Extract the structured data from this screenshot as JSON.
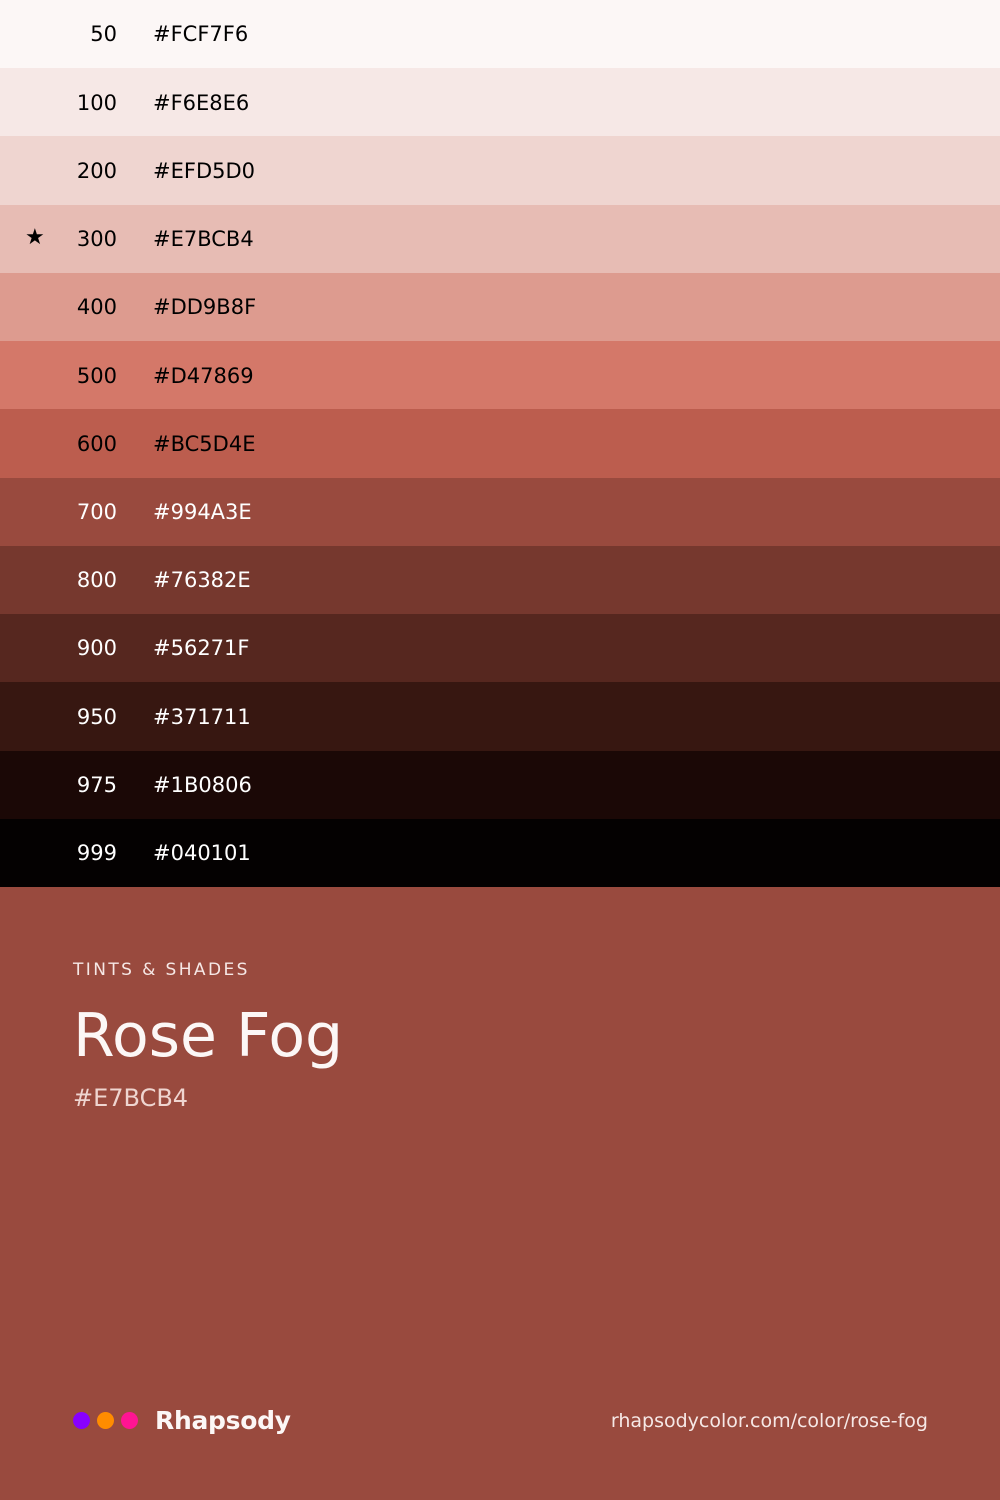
{
  "swatches": [
    {
      "shade": "50",
      "hex": "#FCF7F6",
      "text_color": "#000000",
      "starred": false
    },
    {
      "shade": "100",
      "hex": "#F6E8E6",
      "text_color": "#000000",
      "starred": false
    },
    {
      "shade": "200",
      "hex": "#EFD5D0",
      "text_color": "#000000",
      "starred": false
    },
    {
      "shade": "300",
      "hex": "#E7BCB4",
      "text_color": "#000000",
      "starred": true
    },
    {
      "shade": "400",
      "hex": "#DD9B8F",
      "text_color": "#000000",
      "starred": false
    },
    {
      "shade": "500",
      "hex": "#D47869",
      "text_color": "#000000",
      "starred": false
    },
    {
      "shade": "600",
      "hex": "#BC5D4E",
      "text_color": "#000000",
      "starred": false
    },
    {
      "shade": "700",
      "hex": "#994A3E",
      "text_color": "#FFFFFF",
      "starred": false
    },
    {
      "shade": "800",
      "hex": "#76382E",
      "text_color": "#FFFFFF",
      "starred": false
    },
    {
      "shade": "900",
      "hex": "#56271F",
      "text_color": "#FFFFFF",
      "starred": false
    },
    {
      "shade": "950",
      "hex": "#371711",
      "text_color": "#FFFFFF",
      "starred": false
    },
    {
      "shade": "975",
      "hex": "#1B0806",
      "text_color": "#FFFFFF",
      "starred": false
    },
    {
      "shade": "999",
      "hex": "#040101",
      "text_color": "#FFFFFF",
      "starred": false
    }
  ],
  "star_icon": "star-icon",
  "star_glyph": "★",
  "info": {
    "eyebrow": "TINTS & SHADES",
    "title": "Rose Fog",
    "base_hex": "#E7BCB4"
  },
  "footer": {
    "brand_dots": [
      "#8800FF",
      "#FF8C00",
      "#FF1493"
    ],
    "brand_name": "Rhapsody",
    "url": "rhapsodycolor.com/color/rose-fog"
  },
  "background": "#994A3E"
}
